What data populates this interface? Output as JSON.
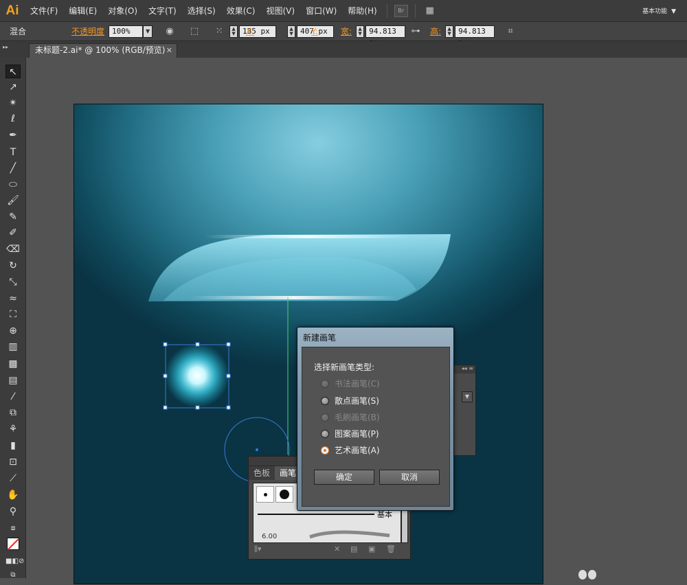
{
  "app": {
    "logo": "Ai"
  },
  "menu": {
    "items": [
      "文件(F)",
      "编辑(E)",
      "对象(O)",
      "文字(T)",
      "选择(S)",
      "效果(C)",
      "视图(V)",
      "窗口(W)",
      "帮助(H)"
    ],
    "bridge_label": "Br",
    "workspace": "基本功能"
  },
  "control": {
    "mode": "混合",
    "opacity_label": "不透明度",
    "opacity_value": "100%",
    "x_label": "X:",
    "x_value": "185 px",
    "y_label": "Y:",
    "y_value": "407 px",
    "w_label": "宽:",
    "w_value": "94.813 p:",
    "h_label": "高:",
    "h_value": "94.813 p:"
  },
  "document": {
    "tab_title": "未标题-2.ai* @ 100% (RGB/预览)"
  },
  "dialog": {
    "title": "新建画笔",
    "question": "选择新画笔类型:",
    "options": [
      {
        "label": "书法画笔(C)",
        "enabled": false,
        "checked": false
      },
      {
        "label": "散点画笔(S)",
        "enabled": true,
        "checked": false
      },
      {
        "label": "毛刷画笔(B)",
        "enabled": false,
        "checked": false
      },
      {
        "label": "图案画笔(P)",
        "enabled": true,
        "checked": false
      },
      {
        "label": "艺术画笔(A)",
        "enabled": true,
        "checked": true
      }
    ],
    "ok_label": "确定",
    "cancel_label": "取消"
  },
  "brushes_panel": {
    "tabs": [
      "色板",
      "画笔"
    ],
    "basic_label": "基本",
    "size_value": "6.00"
  },
  "colors": {
    "accent_orange": "#f0962a",
    "selection_blue": "#3a7bd5",
    "guide_green": "#4cd36a"
  }
}
